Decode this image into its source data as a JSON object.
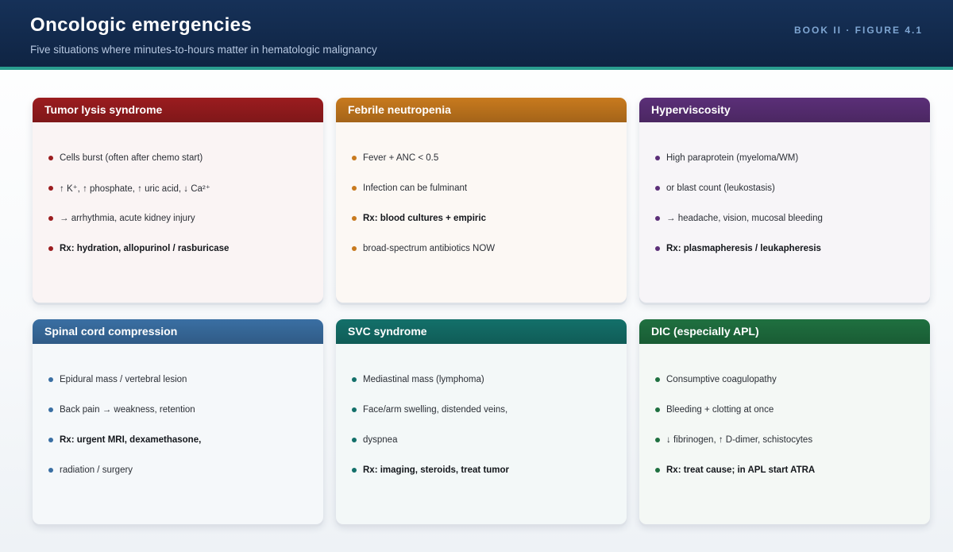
{
  "header": {
    "title": "Oncologic emergencies",
    "subtitle": "Five situations where minutes-to-hours matter in hematologic malignancy",
    "figure_label": "BOOK II · FIGURE 4.1"
  },
  "cards": [
    {
      "title": "Tumor lysis syndrome",
      "color": "#9b1c1f",
      "items": [
        {
          "text": "Cells burst (often after chemo start)",
          "bold": false
        },
        {
          "text": "↑ K⁺, ↑ phosphate, ↑ uric acid, ↓ Ca²⁺",
          "bold": false
        },
        {
          "text": "→ arrhythmia, acute kidney injury",
          "bold": false
        },
        {
          "text": "Rx: hydration, allopurinol / rasburicase",
          "bold": true
        }
      ]
    },
    {
      "title": "Febrile neutropenia",
      "color": "#c87a1e",
      "items": [
        {
          "text": "Fever + ANC < 0.5",
          "bold": false
        },
        {
          "text": "Infection can be fulminant",
          "bold": false
        },
        {
          "text": "Rx: blood cultures + empiric",
          "bold": true
        },
        {
          "text": "broad-spectrum antibiotics NOW",
          "bold": false
        }
      ]
    },
    {
      "title": "Hyperviscosity",
      "color": "#5b2f78",
      "items": [
        {
          "text": "High paraprotein (myeloma/WM)",
          "bold": false
        },
        {
          "text": "or blast count (leukostasis)",
          "bold": false
        },
        {
          "text": "→ headache, vision, mucosal bleeding",
          "bold": false
        },
        {
          "text": "Rx: plasmapheresis / leukapheresis",
          "bold": true
        }
      ]
    },
    {
      "title": "Spinal cord compression",
      "color": "#3a6fa3",
      "items": [
        {
          "text": "Epidural mass / vertebral lesion",
          "bold": false
        },
        {
          "text": "Back pain → weakness, retention",
          "bold": false
        },
        {
          "text": "Rx: urgent MRI, dexamethasone,",
          "bold": true
        },
        {
          "text": "radiation / surgery",
          "bold": false
        }
      ]
    },
    {
      "title": "SVC syndrome",
      "color": "#13706a",
      "items": [
        {
          "text": "Mediastinal mass (lymphoma)",
          "bold": false
        },
        {
          "text": "Face/arm swelling, distended veins,",
          "bold": false
        },
        {
          "text": "dyspnea",
          "bold": false
        },
        {
          "text": "Rx: imaging, steroids, treat tumor",
          "bold": true
        }
      ]
    },
    {
      "title": "DIC (especially APL)",
      "color": "#1f7040",
      "items": [
        {
          "text": "Consumptive coagulopathy",
          "bold": false
        },
        {
          "text": "Bleeding + clotting at once",
          "bold": false
        },
        {
          "text": "↓ fibrinogen, ↑ D-dimer, schistocytes",
          "bold": false
        },
        {
          "text": "Rx: treat cause; in APL start ATRA",
          "bold": true
        }
      ]
    }
  ]
}
